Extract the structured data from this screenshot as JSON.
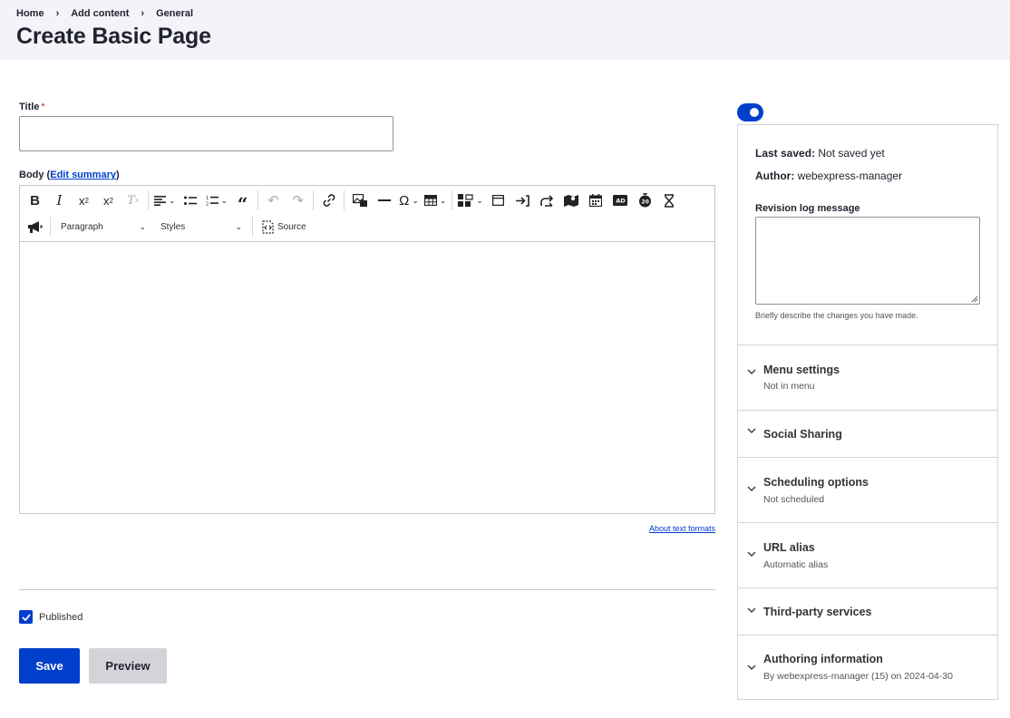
{
  "breadcrumb": [
    {
      "label": "Home"
    },
    {
      "label": "Add content"
    },
    {
      "label": "General"
    }
  ],
  "page_title": "Create Basic Page",
  "form": {
    "title_label": "Title",
    "title_required_marker": "*",
    "title_value": "",
    "body_label": "Body",
    "body_summary_link": "Edit summary",
    "about_text_formats": "About text formats",
    "published_label": "Published",
    "published_checked": true,
    "save_label": "Save",
    "preview_label": "Preview"
  },
  "editor": {
    "paragraph_select": "Paragraph",
    "styles_select": "Styles",
    "source_label": "Source",
    "toolbar_icons": [
      "bold-icon",
      "italic-icon",
      "superscript-icon",
      "subscript-icon",
      "remove-format-icon",
      "align-icon",
      "bulleted-list-icon",
      "numbered-list-icon",
      "blockquote-icon",
      "undo-icon",
      "redo-icon",
      "link-icon",
      "image-icon",
      "horizontal-line-icon",
      "special-characters-icon",
      "table-icon",
      "media-icon",
      "accordion-icon",
      "login-icon",
      "redirect-icon",
      "map-icon",
      "calendar-icon",
      "ad-icon",
      "countdown-icon",
      "hourglass-icon",
      "megaphone-icon"
    ]
  },
  "sidebar": {
    "last_saved_label": "Last saved:",
    "last_saved_value": "Not saved yet",
    "author_label": "Author:",
    "author_value": "webexpress-manager",
    "revision_label": "Revision log message",
    "revision_value": "",
    "revision_desc": "Briefly describe the changes you have made.",
    "sections": [
      {
        "title": "Menu settings",
        "subtitle": "Not in menu"
      },
      {
        "title": "Social Sharing",
        "subtitle": ""
      },
      {
        "title": "Scheduling options",
        "subtitle": "Not scheduled"
      },
      {
        "title": "URL alias",
        "subtitle": "Automatic alias"
      },
      {
        "title": "Third-party services",
        "subtitle": ""
      },
      {
        "title": "Authoring information",
        "subtitle": "By webexpress-manager (15) on 2024-04-30"
      }
    ]
  },
  "colors": {
    "accent": "#003ecc",
    "header_bg": "#f3f4f9",
    "required": "#dc2323"
  }
}
